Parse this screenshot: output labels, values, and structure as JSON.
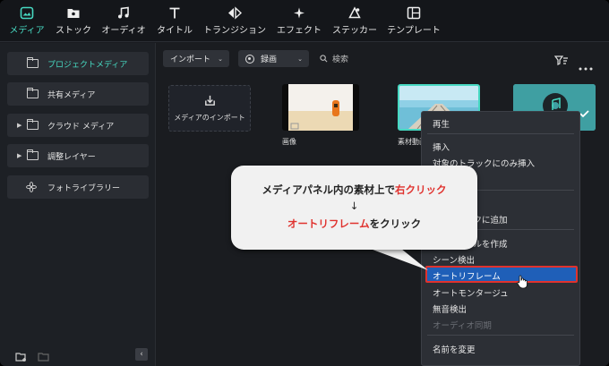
{
  "topnav": {
    "items": [
      {
        "label": "メディア",
        "icon": "media-icon"
      },
      {
        "label": "ストック",
        "icon": "stock-folder-icon"
      },
      {
        "label": "オーディオ",
        "icon": "music-note-icon"
      },
      {
        "label": "タイトル",
        "icon": "text-t-icon"
      },
      {
        "label": "トランジション",
        "icon": "transition-icon"
      },
      {
        "label": "エフェクト",
        "icon": "effect-sparkle-icon"
      },
      {
        "label": "ステッカー",
        "icon": "sticker-icon"
      },
      {
        "label": "テンプレート",
        "icon": "template-icon"
      }
    ],
    "active": "メディア",
    "accent": "#47d9c2"
  },
  "sidebar": {
    "items": [
      {
        "label": "プロジェクトメディア",
        "expandable": false
      },
      {
        "label": "共有メディア",
        "expandable": false
      },
      {
        "label": "クラウド メディア",
        "expandable": true
      },
      {
        "label": "調整レイヤー",
        "expandable": true
      },
      {
        "label": "フォトライブラリー",
        "expandable": false
      }
    ],
    "collapse_glyph": "‹"
  },
  "toolbar": {
    "import_label": "インポート",
    "record_label": "録画",
    "search_placeholder": "検索"
  },
  "media": {
    "import_tile_label": "メディアのインポート",
    "items": [
      {
        "label": "画像"
      },
      {
        "label": "素材動画"
      }
    ]
  },
  "context_menu": {
    "items": [
      {
        "label": "再生",
        "enabled": true
      },
      {
        "label": "挿入",
        "enabled": true
      },
      {
        "label": "対象のトラックにのみ挿入",
        "enabled": true
      },
      {
        "label": "ックに追加",
        "enabled": true
      },
      {
        "label": "イルを作成",
        "enabled": true
      },
      {
        "label": "シーン検出",
        "enabled": true
      },
      {
        "label": "オートリフレーム",
        "enabled": true,
        "highlighted": true
      },
      {
        "label": "オートモンタージュ",
        "enabled": true
      },
      {
        "label": "無音検出",
        "enabled": true
      },
      {
        "label": "オーディオ同期",
        "enabled": false
      },
      {
        "label": "名前を変更",
        "enabled": true
      }
    ],
    "highlight_color": "#1f5fb8",
    "outline_color": "#e0322e"
  },
  "callout": {
    "line1_pre": "メディアパネル内の素材上で",
    "line1_hl": "右クリック",
    "arrow": "↓",
    "line3_hl": "オートリフレーム",
    "line3_post": "をクリック",
    "highlight_color": "#e0322e"
  }
}
